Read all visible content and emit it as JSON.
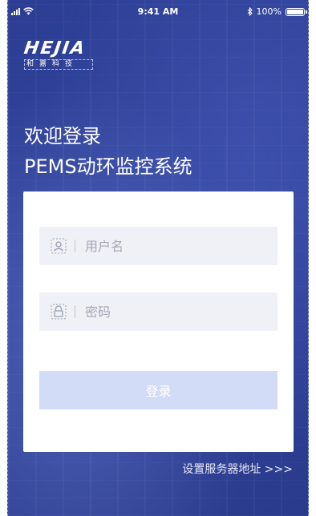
{
  "status_bar": {
    "time": "9:41 AM",
    "battery": "100%",
    "battery_level": 1.0,
    "icons": [
      "signal-icon",
      "wifi-icon",
      "bluetooth-icon",
      "battery-icon"
    ]
  },
  "logo": {
    "mark_text": "HEJIA",
    "sub_text": "和嘉科技"
  },
  "welcome": {
    "line1": "欢迎登录",
    "line2": "PEMS动环监控系统"
  },
  "form": {
    "username_placeholder": "用户名",
    "password_placeholder": "密码",
    "login_label": "登录"
  },
  "server_link": "设置服务器地址 >>>",
  "colors": {
    "background": "#33469e",
    "field_bg": "#f0f1f6",
    "button_bg": "#d3dcf6",
    "icon": "#9aa0b4"
  }
}
